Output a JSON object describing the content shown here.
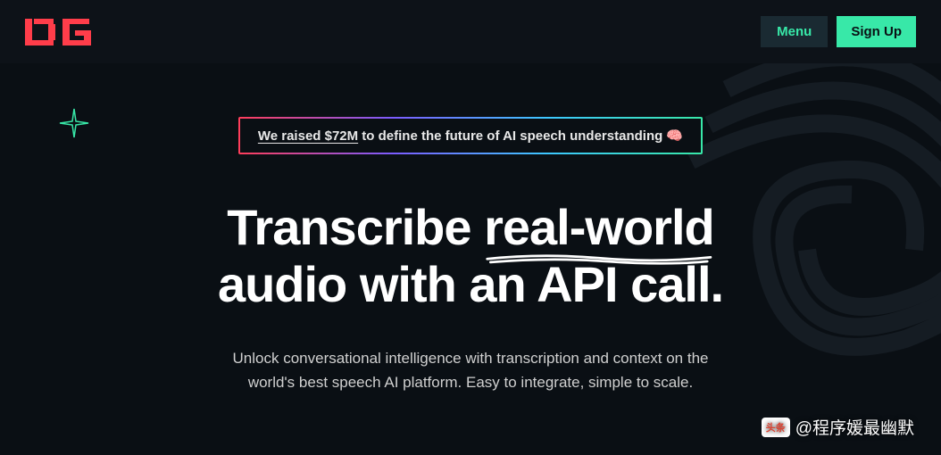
{
  "header": {
    "menu_label": "Menu",
    "signup_label": "Sign Up"
  },
  "banner": {
    "highlight": "We raised $72M",
    "rest": " to define the future of AI speech understanding 🧠"
  },
  "headline": {
    "pre": "Transcribe ",
    "underlined": "real-world",
    "post_line1_end": "",
    "line2": "audio with an API call."
  },
  "subhead": {
    "line1": "Unlock conversational intelligence with transcription and context on the",
    "line2": "world's best speech AI platform. Easy to integrate, simple to scale."
  },
  "watermark": {
    "badge": "头条",
    "text": "@程序媛最幽默"
  }
}
